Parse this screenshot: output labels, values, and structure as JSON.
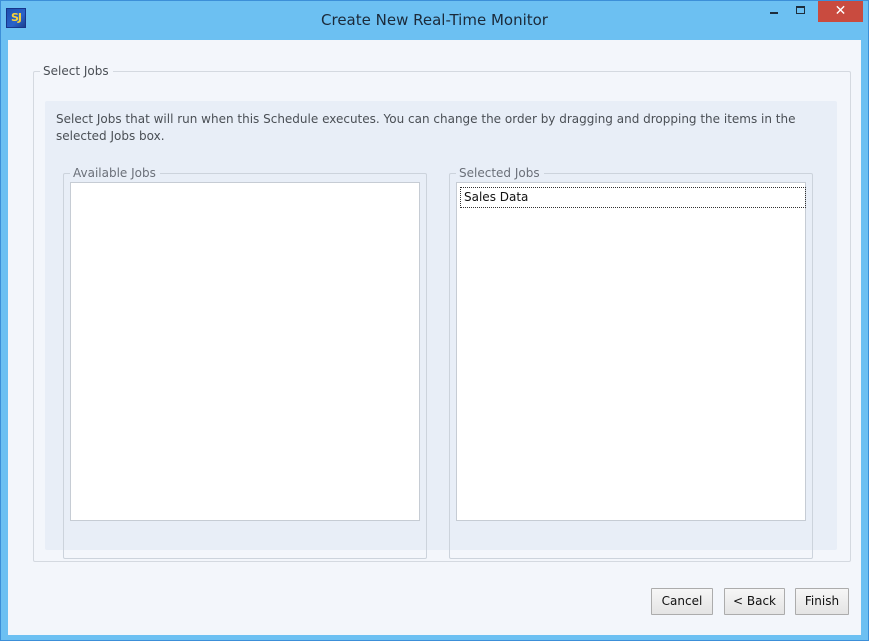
{
  "window": {
    "title": "Create New Real-Time Monitor",
    "icon_text": "SJ",
    "icon_name": "app-logo-icon",
    "controls": {
      "minimize_icon": "minimize-icon",
      "maximize_icon": "maximize-icon",
      "close_label": "✕"
    }
  },
  "select_jobs": {
    "group_label": "Select Jobs",
    "description": "Select Jobs that will run when this Schedule executes. You can change the order by dragging and dropping the items in the selected Jobs box.",
    "available": {
      "label": "Available Jobs",
      "items": []
    },
    "selected": {
      "label": "Selected Jobs",
      "items": [
        "Sales Data"
      ]
    }
  },
  "buttons": {
    "cancel": "Cancel",
    "back": "< Back",
    "finish": "Finish"
  },
  "colors": {
    "titlebar": "#6cc0f2",
    "close_button": "#c94b3f",
    "client_background": "#f3f6fb",
    "inner_panel": "#e8eef7"
  }
}
